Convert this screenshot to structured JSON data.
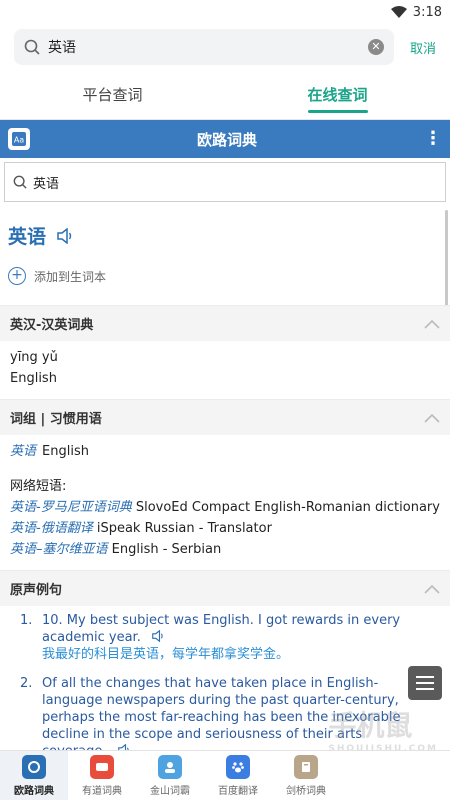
{
  "status": {
    "time": "3:18"
  },
  "search": {
    "query": "英语",
    "cancel": "取消"
  },
  "tabs": [
    {
      "label": "平台查词"
    },
    {
      "label": "在线查词"
    }
  ],
  "dict": {
    "title": "欧路词典",
    "query": "英语"
  },
  "entry": {
    "headword": "英语",
    "add_label": "添加到生词本"
  },
  "sections": {
    "dict_head": "英汉-汉英词典",
    "pinyin": "yīng yǔ",
    "meaning": "English",
    "phrases_head": "词组 | 习惯用语",
    "phrase_main": {
      "zh": "英语",
      "en": "English"
    },
    "web_label": "网络短语:",
    "web_phrases": [
      {
        "zh": "英语-罗马尼亚语词典",
        "en": "SlovoEd Compact English-Romanian dictionary"
      },
      {
        "zh": "英语-俄语翻译",
        "en": "iSpeak Russian - Translator"
      },
      {
        "zh": "英语–塞尔维亚语",
        "en": "English - Serbian"
      }
    ],
    "examples_head": "原声例句"
  },
  "examples": [
    {
      "num": "1.",
      "en": "10. My best subject was English. I got rewards in every academic year.",
      "zh": "我最好的科目是英语，每学年都拿奖学金。"
    },
    {
      "num": "2.",
      "en": "Of all the changes that have taken place in English-language newspapers during the past quarter-century, perhaps the most far-reaching has been the inexorable decline in the scope and seriousness of their arts coverage.",
      "zh": ""
    }
  ],
  "bottom_nav": [
    {
      "label": "欧路词典",
      "icon": "eudic-icon",
      "color": "#2a6fb4"
    },
    {
      "label": "有道词典",
      "icon": "youdao-icon",
      "color": "#e74c3c"
    },
    {
      "label": "金山词霸",
      "icon": "iciba-icon",
      "color": "#4fa3e0"
    },
    {
      "label": "百度翻译",
      "icon": "baidu-icon",
      "color": "#3b7de0"
    },
    {
      "label": "剑桥词典",
      "icon": "cambridge-icon",
      "color": "#b9a58a"
    }
  ],
  "watermark": {
    "text": "手机鼠",
    "sub": "SHOUJISHU.COM"
  },
  "colors": {
    "accent": "#1aa58a",
    "dict_bar": "#3a7bbf",
    "link": "#2a6fb4"
  }
}
